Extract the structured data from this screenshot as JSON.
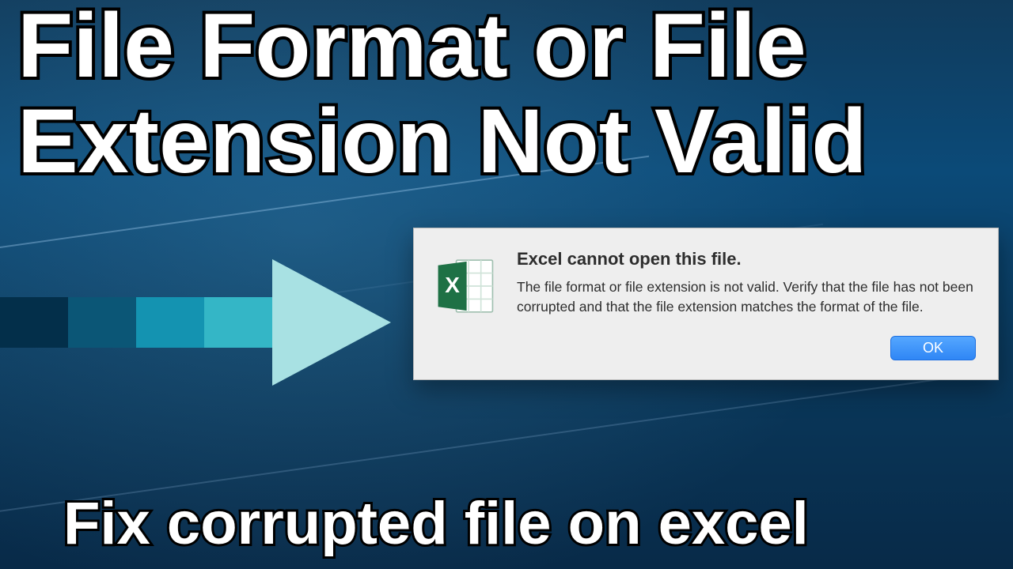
{
  "headline": {
    "line1": "File Format or File",
    "line2": "Extension Not Valid"
  },
  "subline": "Fix corrupted file on excel",
  "dialog": {
    "title": "Excel cannot open this file.",
    "message": "The file format or file extension is not valid. Verify that the file has not been corrupted and that the file extension matches the format of the file.",
    "ok_label": "OK"
  }
}
